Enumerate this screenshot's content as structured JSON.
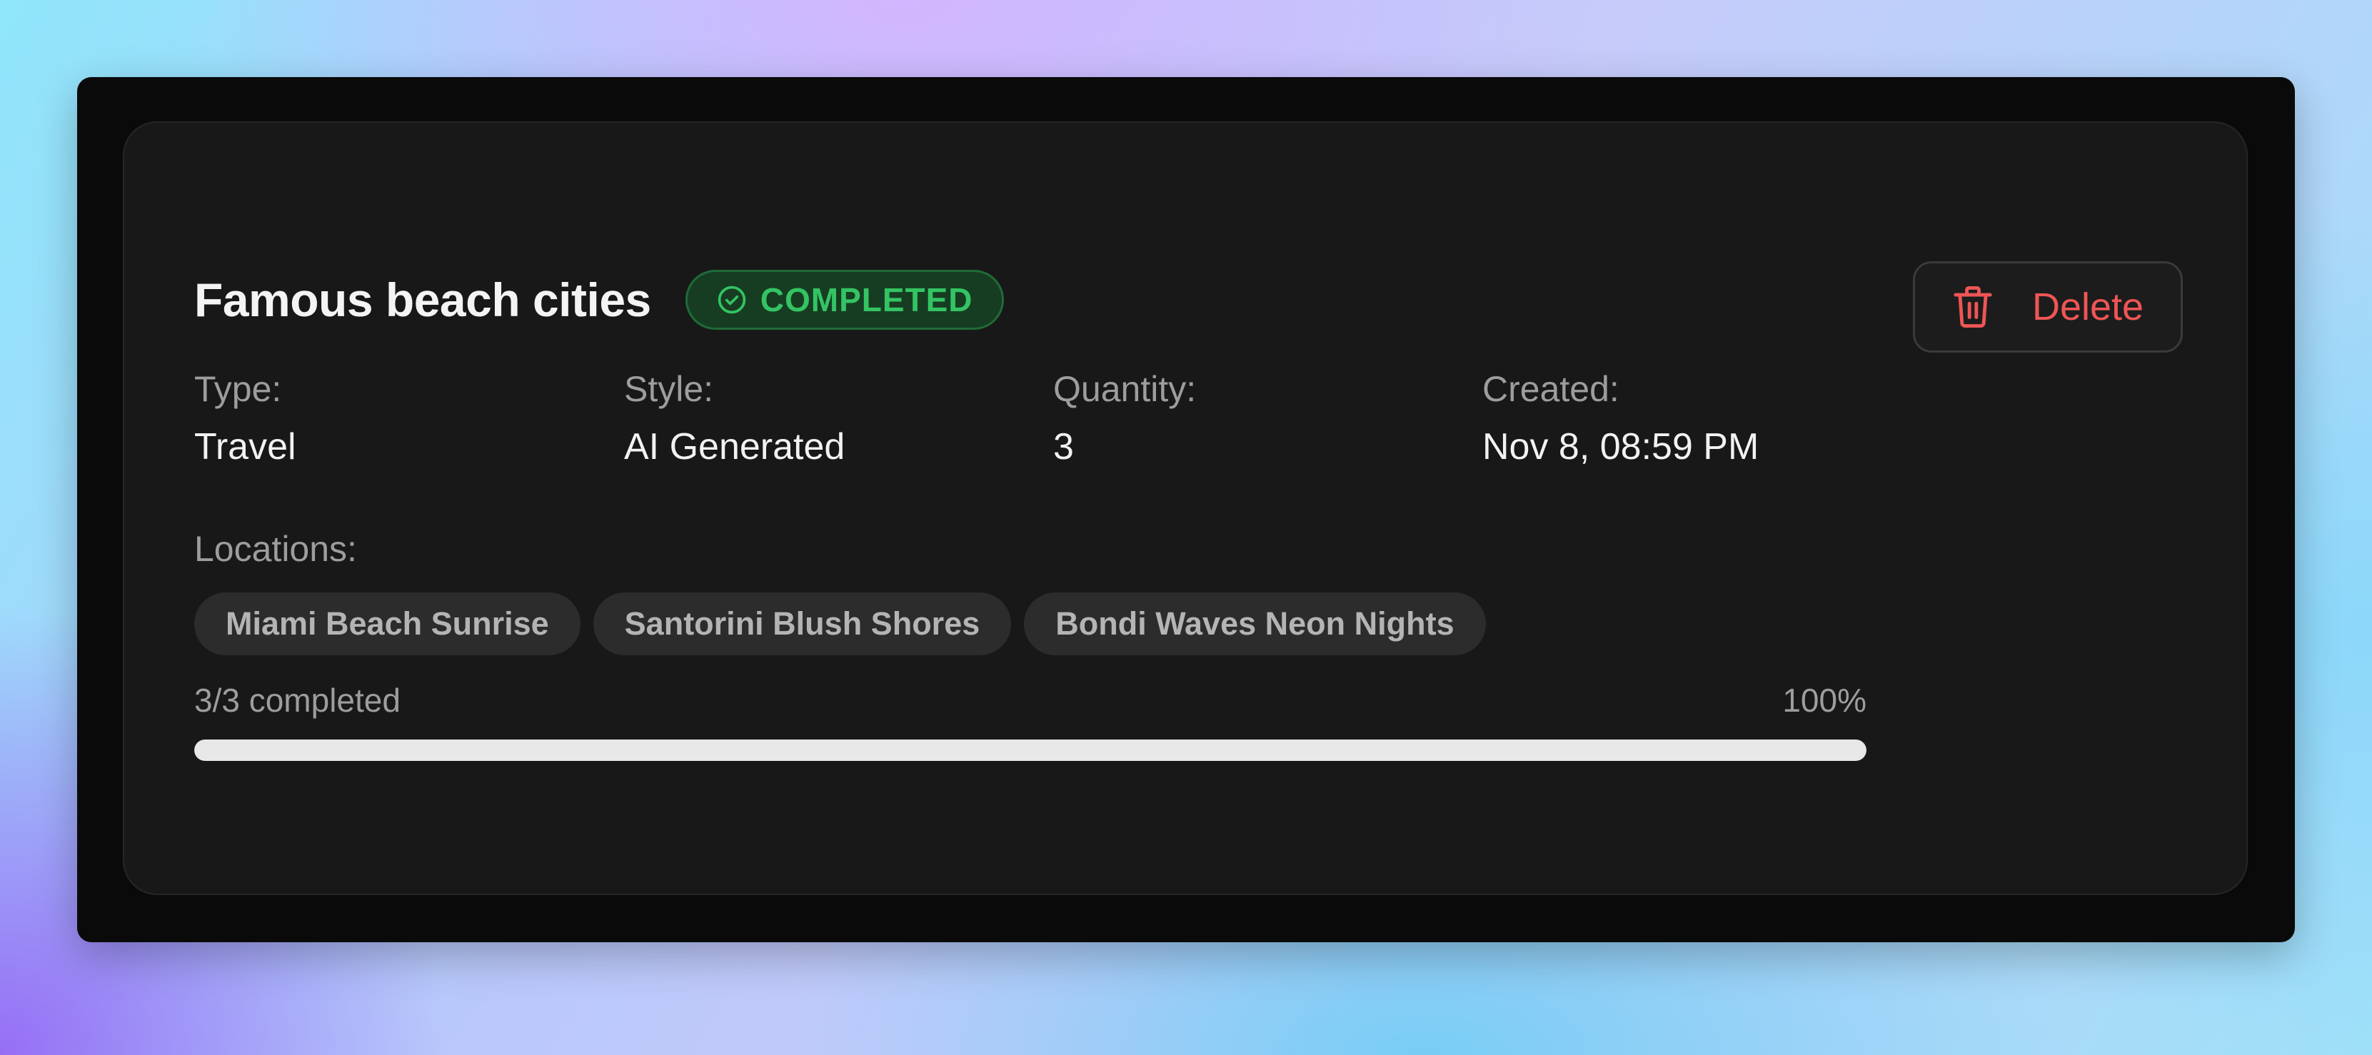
{
  "job": {
    "title": "Famous beach cities",
    "status": "COMPLETED",
    "status_icon": "check-circle-icon",
    "delete_label": "Delete",
    "delete_icon": "trash-icon"
  },
  "meta": [
    {
      "label": "Type:",
      "value": "Travel"
    },
    {
      "label": "Style:",
      "value": "AI Generated"
    },
    {
      "label": "Quantity:",
      "value": "3"
    },
    {
      "label": "Created:",
      "value": "Nov 8, 08:59 PM"
    }
  ],
  "locations": {
    "label": "Locations:",
    "items": [
      "Miami Beach Sunrise",
      "Santorini Blush Shores",
      "Bondi Waves Neon Nights"
    ]
  },
  "progress": {
    "text": "3/3 completed",
    "percent_label": "100%",
    "fraction": 1.0
  },
  "colors": {
    "status_green": "#34c463",
    "delete_red": "#ef5555",
    "card_bg": "#181818",
    "window_bg": "#0a0a0a"
  }
}
